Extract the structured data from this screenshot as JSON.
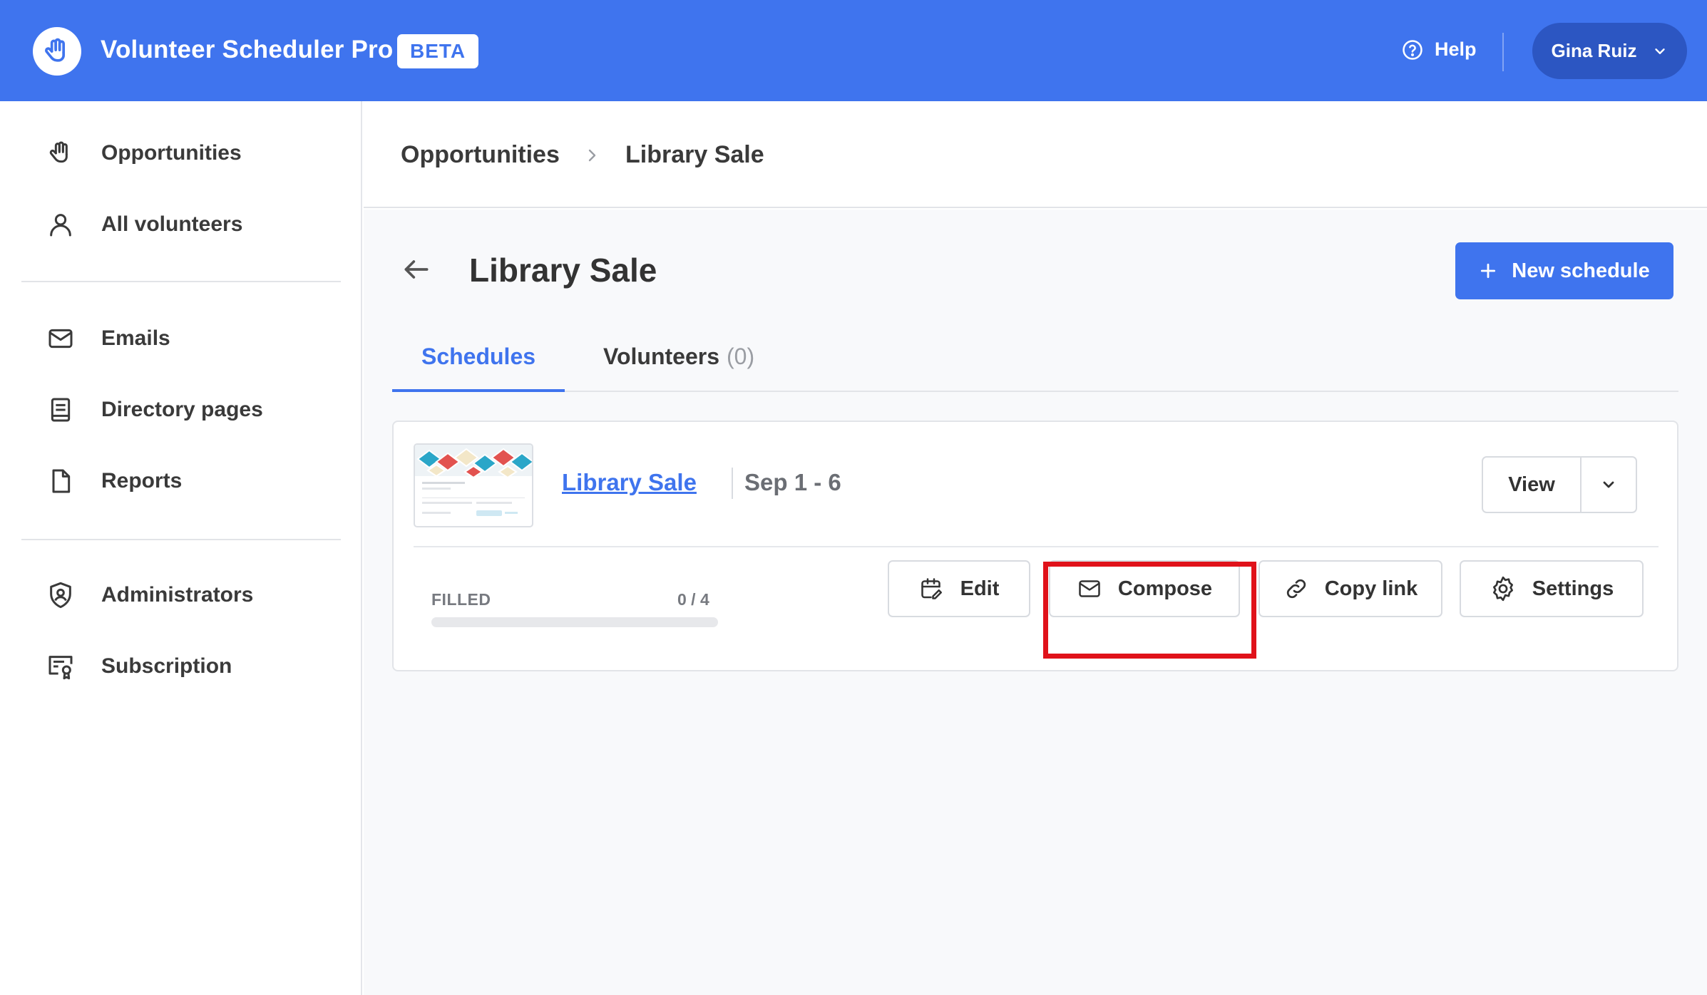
{
  "app": {
    "title": "Volunteer Scheduler Pro",
    "badge": "BETA"
  },
  "header": {
    "help_label": "Help",
    "user_name": "Gina Ruiz"
  },
  "sidebar": {
    "items": [
      {
        "label": "Opportunities",
        "icon": "hand-icon"
      },
      {
        "label": "All volunteers",
        "icon": "user-icon"
      },
      {
        "label": "Emails",
        "icon": "mail-icon"
      },
      {
        "label": "Directory pages",
        "icon": "book-icon"
      },
      {
        "label": "Reports",
        "icon": "file-icon"
      },
      {
        "label": "Administrators",
        "icon": "shield-user-icon"
      },
      {
        "label": "Subscription",
        "icon": "certificate-icon"
      }
    ]
  },
  "breadcrumb": {
    "parent": "Opportunities",
    "current": "Library Sale"
  },
  "page": {
    "title": "Library Sale",
    "new_button": "New schedule"
  },
  "tabs": {
    "schedules": "Schedules",
    "volunteers": "Volunteers",
    "volunteers_count": "(0)"
  },
  "schedule": {
    "name": "Library Sale",
    "dates": "Sep 1 - 6",
    "view_label": "View",
    "filled_label": "FILLED",
    "filled_count": "0 / 4",
    "filled_fraction": 0,
    "actions": {
      "edit": "Edit",
      "compose": "Compose",
      "copy_link": "Copy link",
      "settings": "Settings"
    }
  },
  "colors": {
    "brand": "#3f74ee",
    "highlight": "#e0121a"
  }
}
